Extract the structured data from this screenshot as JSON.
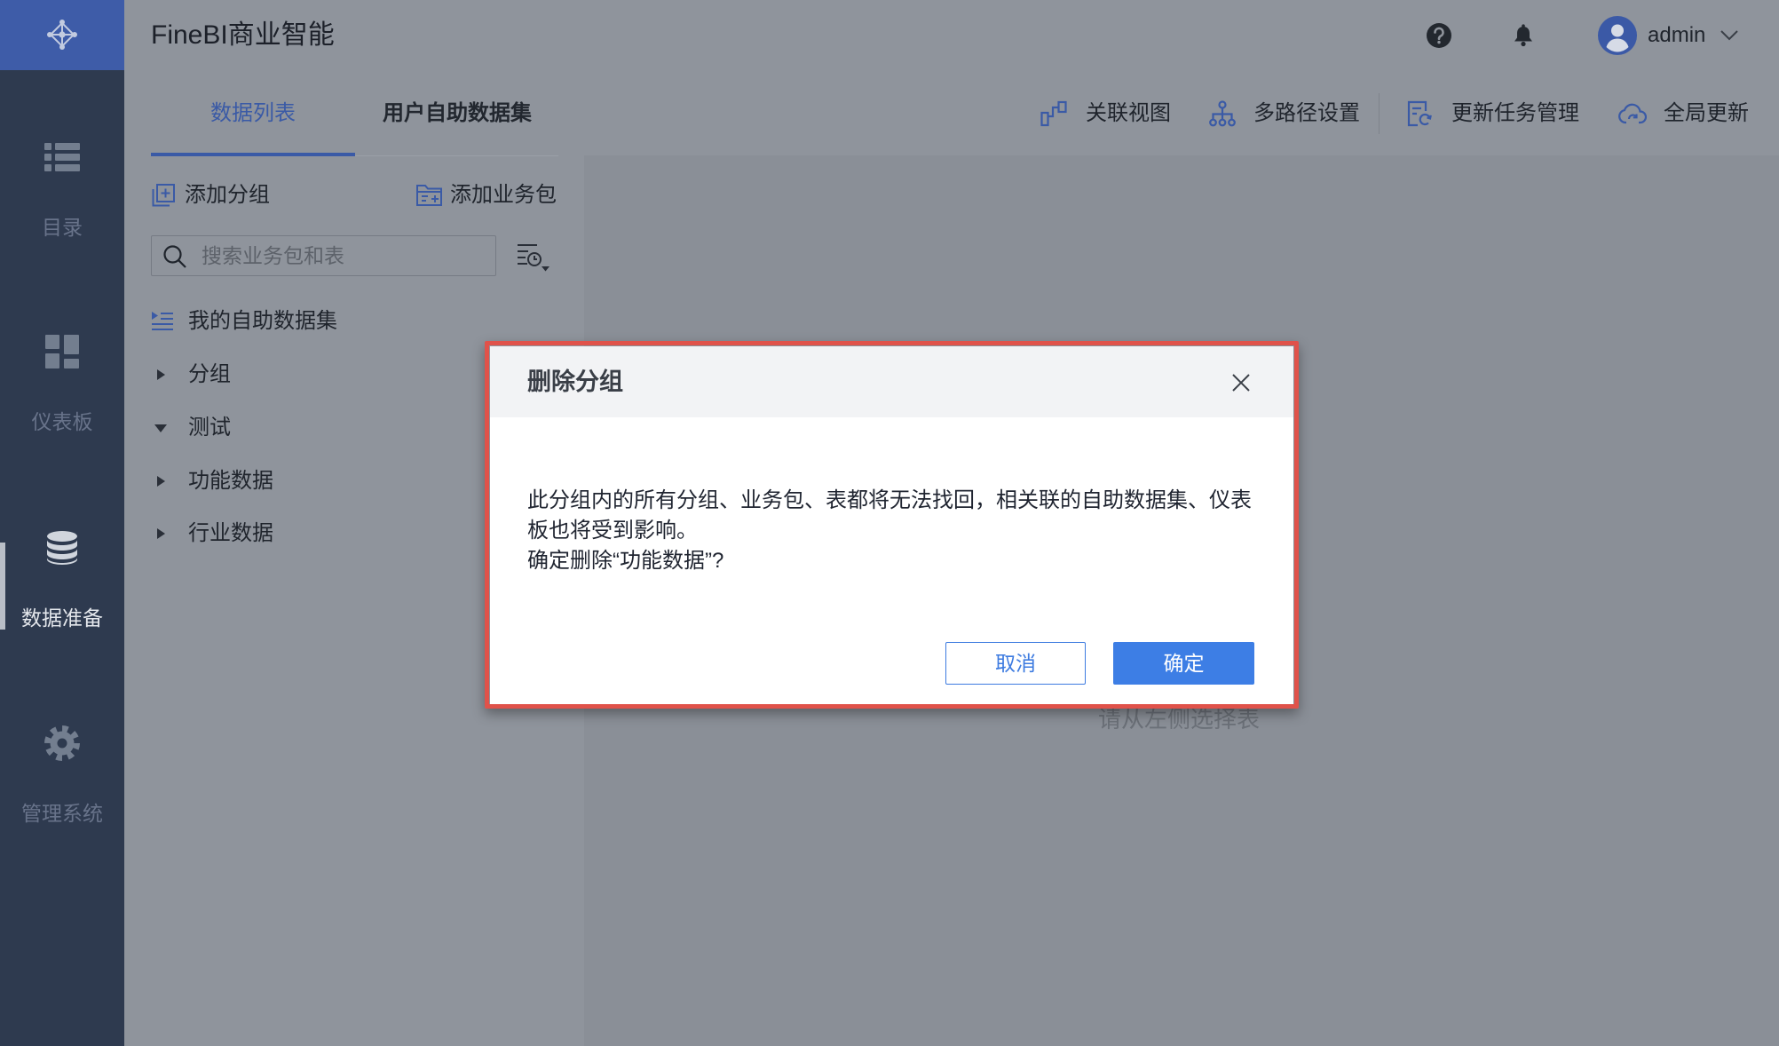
{
  "app": {
    "title": "FineBI商业智能",
    "logo_icon": "logo-icon"
  },
  "header": {
    "help_icon": "help-icon",
    "notification_icon": "bell-icon",
    "avatar_icon": "avatar-icon",
    "user_name": "admin",
    "menu_icon": "chevron-down-icon"
  },
  "sidebar": {
    "items": [
      {
        "label": "目录",
        "icon": "list-icon",
        "active": false
      },
      {
        "label": "仪表板",
        "icon": "dashboard-icon",
        "active": false
      },
      {
        "label": "数据准备",
        "icon": "database-icon",
        "active": true
      },
      {
        "label": "管理系统",
        "icon": "gear-icon",
        "active": false
      }
    ]
  },
  "tabs": [
    {
      "label": "数据列表",
      "active": true
    },
    {
      "label": "用户自助数据集",
      "active": false
    }
  ],
  "toolbar": {
    "items": [
      {
        "label": "关联视图",
        "icon": "relation-view-icon"
      },
      {
        "label": "多路径设置",
        "icon": "multi-path-icon"
      },
      {
        "label": "更新任务管理",
        "icon": "update-task-icon"
      },
      {
        "label": "全局更新",
        "icon": "global-update-icon"
      }
    ]
  },
  "panel": {
    "add_group": {
      "label": "添加分组",
      "icon": "add-group-icon"
    },
    "add_package": {
      "label": "添加业务包",
      "icon": "add-package-icon"
    },
    "search": {
      "placeholder": "搜索业务包和表",
      "value": "",
      "icon": "search-icon"
    },
    "filter_icon": "filter-icon",
    "tree": [
      {
        "label": "我的自助数据集",
        "icon": "self-service-dataset-icon"
      },
      {
        "label": "分组",
        "expanded": false
      },
      {
        "label": "测试",
        "expanded": true
      },
      {
        "label": "功能数据",
        "expanded": false
      },
      {
        "label": "行业数据",
        "expanded": false
      }
    ]
  },
  "content": {
    "empty_hint": "请从左侧选择表"
  },
  "dialog": {
    "title": "删除分组",
    "close_icon": "close-icon",
    "message": "此分组内的所有分组、业务包、表都将无法找回，相关联的自助数据集、仪表板也将受到影响。",
    "question": "确定删除“功能数据”?",
    "cancel_label": "取消",
    "confirm_label": "确定"
  },
  "colors": {
    "sidebar": "#2e3a4f",
    "accent": "#3a5aa6",
    "confirm_button": "#3d7ee5",
    "highlight_frame": "#e0524a"
  }
}
